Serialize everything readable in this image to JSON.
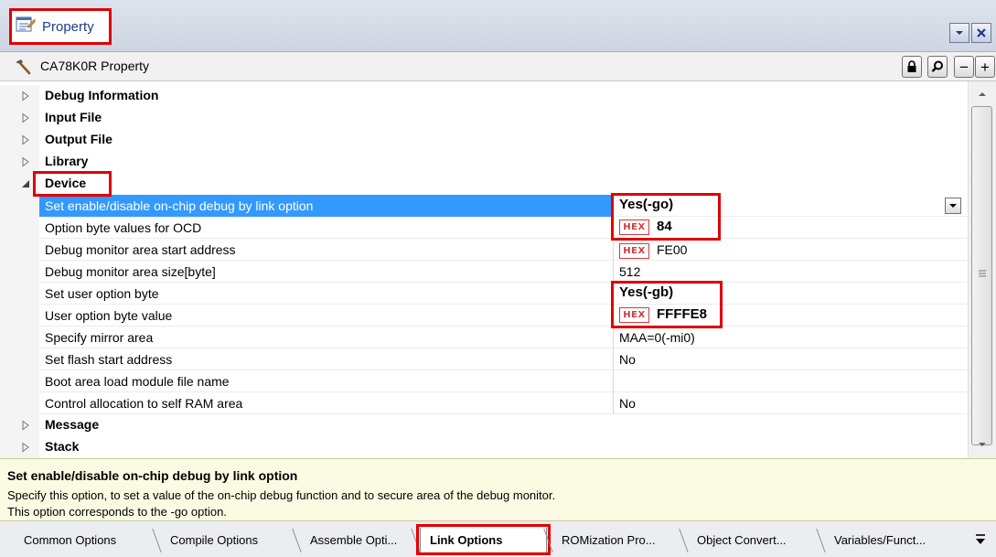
{
  "window": {
    "title": "Property"
  },
  "header": {
    "title": "CA78K0R Property",
    "minus_label": "−",
    "plus_label": "+"
  },
  "rows": [
    {
      "kind": "category",
      "label": "Debug Information",
      "expanded": false
    },
    {
      "kind": "category",
      "label": "Input File",
      "expanded": false
    },
    {
      "kind": "category",
      "label": "Output File",
      "expanded": false
    },
    {
      "kind": "category",
      "label": "Library",
      "expanded": false
    },
    {
      "kind": "category",
      "label": "Device",
      "expanded": true
    },
    {
      "kind": "property",
      "label": "Set enable/disable on-chip debug by link option",
      "value": "Yes(-go)",
      "bold": true,
      "hex": false,
      "selected": true
    },
    {
      "kind": "property",
      "label": "Option byte values for OCD",
      "value": "84",
      "bold": true,
      "hex": true
    },
    {
      "kind": "property",
      "label": "Debug monitor area start address",
      "value": "FE00",
      "bold": false,
      "hex": true
    },
    {
      "kind": "property",
      "label": "Debug monitor area size[byte]",
      "value": "512",
      "bold": false,
      "hex": false
    },
    {
      "kind": "property",
      "label": "Set user option byte",
      "value": "Yes(-gb)",
      "bold": true,
      "hex": false
    },
    {
      "kind": "property",
      "label": "User option byte value",
      "value": "FFFFE8",
      "bold": true,
      "hex": true
    },
    {
      "kind": "property",
      "label": "Specify mirror area",
      "value": "MAA=0(-mi0)",
      "bold": false,
      "hex": false
    },
    {
      "kind": "property",
      "label": "Set flash start address",
      "value": "No",
      "bold": false,
      "hex": false
    },
    {
      "kind": "property",
      "label": "Boot area load module file name",
      "value": "",
      "bold": false,
      "hex": false
    },
    {
      "kind": "property",
      "label": "Control allocation to self RAM area",
      "value": "No",
      "bold": false,
      "hex": false
    },
    {
      "kind": "category",
      "label": "Message",
      "expanded": false
    },
    {
      "kind": "category",
      "label": "Stack",
      "expanded": false
    }
  ],
  "hex_badge": "HEX",
  "description": {
    "title": "Set enable/disable on-chip debug by link option",
    "line1": "Specify this option, to set a value of the on-chip debug function and to secure area of the debug monitor.",
    "line2": "This option corresponds to the -go option."
  },
  "tabs": [
    {
      "label": "Common Options",
      "active": false
    },
    {
      "label": "Compile Options",
      "active": false
    },
    {
      "label": "Assemble Opti...",
      "active": false
    },
    {
      "label": "Link Options",
      "active": true
    },
    {
      "label": "ROMization Pro...",
      "active": false
    },
    {
      "label": "Object Convert...",
      "active": false
    },
    {
      "label": "Variables/Funct...",
      "active": false
    }
  ],
  "colors": {
    "highlight": "#e00000",
    "selection": "#3399ff",
    "hex_badge": "#d23b3b"
  }
}
